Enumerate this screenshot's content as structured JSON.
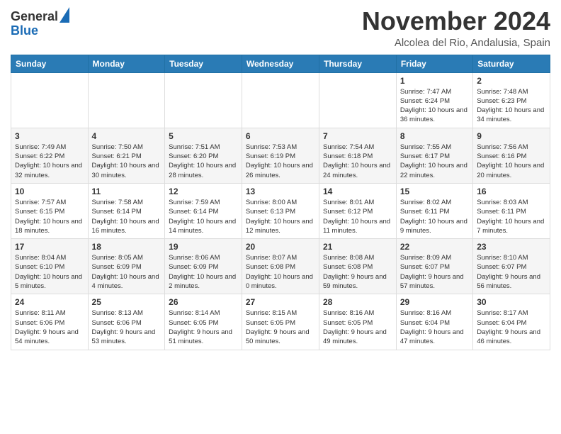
{
  "logo": {
    "general": "General",
    "blue": "Blue"
  },
  "header": {
    "month": "November 2024",
    "location": "Alcolea del Rio, Andalusia, Spain"
  },
  "weekdays": [
    "Sunday",
    "Monday",
    "Tuesday",
    "Wednesday",
    "Thursday",
    "Friday",
    "Saturday"
  ],
  "weeks": [
    [
      {
        "day": "",
        "content": ""
      },
      {
        "day": "",
        "content": ""
      },
      {
        "day": "",
        "content": ""
      },
      {
        "day": "",
        "content": ""
      },
      {
        "day": "",
        "content": ""
      },
      {
        "day": "1",
        "content": "Sunrise: 7:47 AM\nSunset: 6:24 PM\nDaylight: 10 hours and 36 minutes."
      },
      {
        "day": "2",
        "content": "Sunrise: 7:48 AM\nSunset: 6:23 PM\nDaylight: 10 hours and 34 minutes."
      }
    ],
    [
      {
        "day": "3",
        "content": "Sunrise: 7:49 AM\nSunset: 6:22 PM\nDaylight: 10 hours and 32 minutes."
      },
      {
        "day": "4",
        "content": "Sunrise: 7:50 AM\nSunset: 6:21 PM\nDaylight: 10 hours and 30 minutes."
      },
      {
        "day": "5",
        "content": "Sunrise: 7:51 AM\nSunset: 6:20 PM\nDaylight: 10 hours and 28 minutes."
      },
      {
        "day": "6",
        "content": "Sunrise: 7:53 AM\nSunset: 6:19 PM\nDaylight: 10 hours and 26 minutes."
      },
      {
        "day": "7",
        "content": "Sunrise: 7:54 AM\nSunset: 6:18 PM\nDaylight: 10 hours and 24 minutes."
      },
      {
        "day": "8",
        "content": "Sunrise: 7:55 AM\nSunset: 6:17 PM\nDaylight: 10 hours and 22 minutes."
      },
      {
        "day": "9",
        "content": "Sunrise: 7:56 AM\nSunset: 6:16 PM\nDaylight: 10 hours and 20 minutes."
      }
    ],
    [
      {
        "day": "10",
        "content": "Sunrise: 7:57 AM\nSunset: 6:15 PM\nDaylight: 10 hours and 18 minutes."
      },
      {
        "day": "11",
        "content": "Sunrise: 7:58 AM\nSunset: 6:14 PM\nDaylight: 10 hours and 16 minutes."
      },
      {
        "day": "12",
        "content": "Sunrise: 7:59 AM\nSunset: 6:14 PM\nDaylight: 10 hours and 14 minutes."
      },
      {
        "day": "13",
        "content": "Sunrise: 8:00 AM\nSunset: 6:13 PM\nDaylight: 10 hours and 12 minutes."
      },
      {
        "day": "14",
        "content": "Sunrise: 8:01 AM\nSunset: 6:12 PM\nDaylight: 10 hours and 11 minutes."
      },
      {
        "day": "15",
        "content": "Sunrise: 8:02 AM\nSunset: 6:11 PM\nDaylight: 10 hours and 9 minutes."
      },
      {
        "day": "16",
        "content": "Sunrise: 8:03 AM\nSunset: 6:11 PM\nDaylight: 10 hours and 7 minutes."
      }
    ],
    [
      {
        "day": "17",
        "content": "Sunrise: 8:04 AM\nSunset: 6:10 PM\nDaylight: 10 hours and 5 minutes."
      },
      {
        "day": "18",
        "content": "Sunrise: 8:05 AM\nSunset: 6:09 PM\nDaylight: 10 hours and 4 minutes."
      },
      {
        "day": "19",
        "content": "Sunrise: 8:06 AM\nSunset: 6:09 PM\nDaylight: 10 hours and 2 minutes."
      },
      {
        "day": "20",
        "content": "Sunrise: 8:07 AM\nSunset: 6:08 PM\nDaylight: 10 hours and 0 minutes."
      },
      {
        "day": "21",
        "content": "Sunrise: 8:08 AM\nSunset: 6:08 PM\nDaylight: 9 hours and 59 minutes."
      },
      {
        "day": "22",
        "content": "Sunrise: 8:09 AM\nSunset: 6:07 PM\nDaylight: 9 hours and 57 minutes."
      },
      {
        "day": "23",
        "content": "Sunrise: 8:10 AM\nSunset: 6:07 PM\nDaylight: 9 hours and 56 minutes."
      }
    ],
    [
      {
        "day": "24",
        "content": "Sunrise: 8:11 AM\nSunset: 6:06 PM\nDaylight: 9 hours and 54 minutes."
      },
      {
        "day": "25",
        "content": "Sunrise: 8:13 AM\nSunset: 6:06 PM\nDaylight: 9 hours and 53 minutes."
      },
      {
        "day": "26",
        "content": "Sunrise: 8:14 AM\nSunset: 6:05 PM\nDaylight: 9 hours and 51 minutes."
      },
      {
        "day": "27",
        "content": "Sunrise: 8:15 AM\nSunset: 6:05 PM\nDaylight: 9 hours and 50 minutes."
      },
      {
        "day": "28",
        "content": "Sunrise: 8:16 AM\nSunset: 6:05 PM\nDaylight: 9 hours and 49 minutes."
      },
      {
        "day": "29",
        "content": "Sunrise: 8:16 AM\nSunset: 6:04 PM\nDaylight: 9 hours and 47 minutes."
      },
      {
        "day": "30",
        "content": "Sunrise: 8:17 AM\nSunset: 6:04 PM\nDaylight: 9 hours and 46 minutes."
      }
    ]
  ]
}
